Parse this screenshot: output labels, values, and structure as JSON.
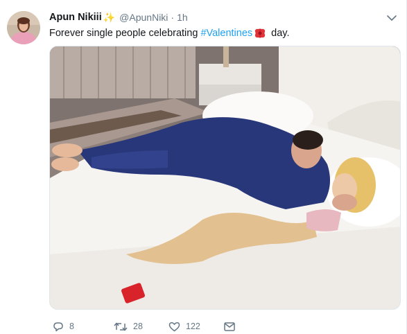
{
  "tweet": {
    "display_name": "Apun Nikiii",
    "name_emoji": "✨",
    "handle": "@ApunNiki",
    "separator": "·",
    "time": "1h",
    "text_before": "Forever single people celebrating ",
    "hashtag": "#Valentines",
    "text_after": " day.",
    "emoji_name": "rose-icon"
  },
  "actions": {
    "replies": "8",
    "retweets": "28",
    "likes": "122"
  },
  "colors": {
    "link": "#1da1f2",
    "muted": "#657786",
    "text": "#14171a"
  }
}
